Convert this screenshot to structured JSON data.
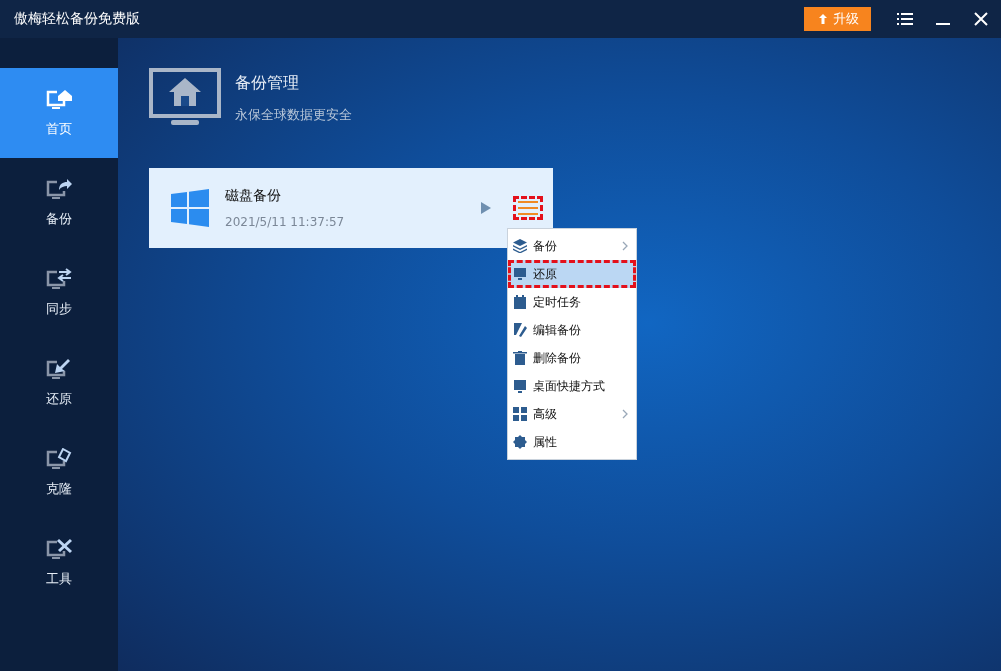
{
  "window": {
    "title": "傲梅轻松备份免费版",
    "upgrade_button": "升级"
  },
  "sidebar": {
    "items": [
      {
        "label": "首页",
        "selected": true
      },
      {
        "label": "备份",
        "selected": false
      },
      {
        "label": "同步",
        "selected": false
      },
      {
        "label": "还原",
        "selected": false
      },
      {
        "label": "克隆",
        "selected": false
      },
      {
        "label": "工具",
        "selected": false
      }
    ]
  },
  "header": {
    "title": "备份管理",
    "subtitle": "永保全球数据更安全"
  },
  "backup_task": {
    "name": "磁盘备份",
    "time": "2021/5/11 11:37:57"
  },
  "context_menu": {
    "items": [
      {
        "label": "备份",
        "selected": false,
        "has_submenu": true
      },
      {
        "label": "还原",
        "selected": true,
        "has_submenu": false
      },
      {
        "label": "定时任务",
        "selected": false,
        "has_submenu": false
      },
      {
        "label": "编辑备份",
        "selected": false,
        "has_submenu": false
      },
      {
        "label": "删除备份",
        "selected": false,
        "has_submenu": false
      },
      {
        "label": "桌面快捷方式",
        "selected": false,
        "has_submenu": false
      },
      {
        "label": "高级",
        "selected": false,
        "has_submenu": true
      },
      {
        "label": "属性",
        "selected": false,
        "has_submenu": false
      }
    ]
  }
}
